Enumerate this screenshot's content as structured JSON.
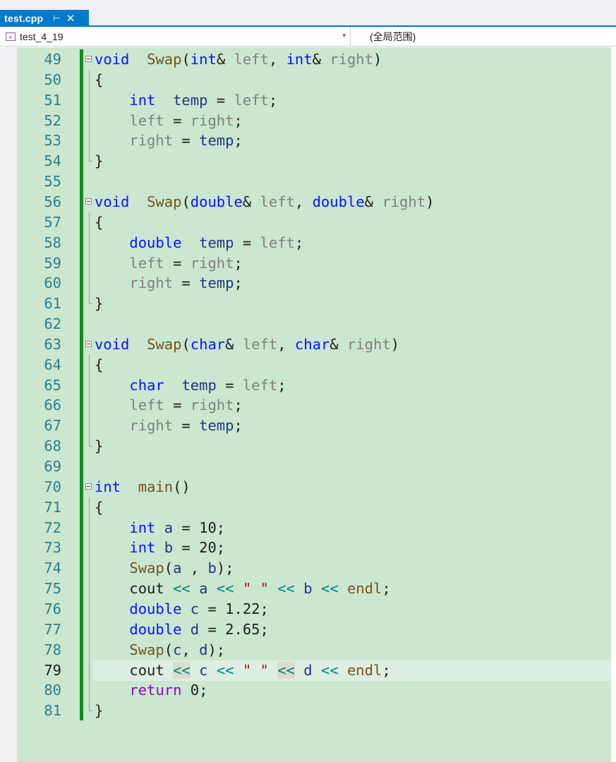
{
  "tab": {
    "title": "test.cpp",
    "pin_glyph": "⊢",
    "close_glyph": "✕"
  },
  "navbar": {
    "project": "test_4_19",
    "scope": "(全局范围)",
    "project_icon": "project-icon"
  },
  "editor": {
    "current_line": 79,
    "lines": [
      {
        "num": "49",
        "segs": [
          [
            "kw",
            "void"
          ],
          [
            "",
            "  "
          ],
          [
            "fn",
            "Swap"
          ],
          [
            "",
            "("
          ],
          [
            "kw",
            "int"
          ],
          [
            "",
            "& "
          ],
          [
            "prm",
            "left"
          ],
          [
            "",
            ", "
          ],
          [
            "kw",
            "int"
          ],
          [
            "",
            "& "
          ],
          [
            "prm",
            "right"
          ],
          [
            "",
            ")"
          ]
        ]
      },
      {
        "num": "50",
        "segs": [
          [
            "",
            "{"
          ]
        ]
      },
      {
        "num": "51",
        "segs": [
          [
            "",
            "    "
          ],
          [
            "kw",
            "int"
          ],
          [
            "",
            "  "
          ],
          [
            "lv",
            "temp"
          ],
          [
            "",
            " = "
          ],
          [
            "prm",
            "left"
          ],
          [
            "",
            ";"
          ]
        ]
      },
      {
        "num": "52",
        "segs": [
          [
            "",
            "    "
          ],
          [
            "prm",
            "left"
          ],
          [
            "",
            " = "
          ],
          [
            "prm",
            "right"
          ],
          [
            "",
            ";"
          ]
        ]
      },
      {
        "num": "53",
        "segs": [
          [
            "",
            "    "
          ],
          [
            "prm",
            "right"
          ],
          [
            "",
            " = "
          ],
          [
            "lv",
            "temp"
          ],
          [
            "",
            ";"
          ]
        ]
      },
      {
        "num": "54",
        "segs": [
          [
            "",
            "}"
          ]
        ]
      },
      {
        "num": "55",
        "segs": []
      },
      {
        "num": "56",
        "segs": [
          [
            "kw",
            "void"
          ],
          [
            "",
            "  "
          ],
          [
            "fn",
            "Swap"
          ],
          [
            "",
            "("
          ],
          [
            "kw",
            "double"
          ],
          [
            "",
            "& "
          ],
          [
            "prm",
            "left"
          ],
          [
            "",
            ", "
          ],
          [
            "kw",
            "double"
          ],
          [
            "",
            "& "
          ],
          [
            "prm",
            "right"
          ],
          [
            "",
            ")"
          ]
        ]
      },
      {
        "num": "57",
        "segs": [
          [
            "",
            "{"
          ]
        ]
      },
      {
        "num": "58",
        "segs": [
          [
            "",
            "    "
          ],
          [
            "kw",
            "double"
          ],
          [
            "",
            "  "
          ],
          [
            "lv",
            "temp"
          ],
          [
            "",
            " = "
          ],
          [
            "prm",
            "left"
          ],
          [
            "",
            ";"
          ]
        ]
      },
      {
        "num": "59",
        "segs": [
          [
            "",
            "    "
          ],
          [
            "prm",
            "left"
          ],
          [
            "",
            " = "
          ],
          [
            "prm",
            "right"
          ],
          [
            "",
            ";"
          ]
        ]
      },
      {
        "num": "60",
        "segs": [
          [
            "",
            "    "
          ],
          [
            "prm",
            "right"
          ],
          [
            "",
            " = "
          ],
          [
            "lv",
            "temp"
          ],
          [
            "",
            ";"
          ]
        ]
      },
      {
        "num": "61",
        "segs": [
          [
            "",
            "}"
          ]
        ]
      },
      {
        "num": "62",
        "segs": []
      },
      {
        "num": "63",
        "segs": [
          [
            "kw",
            "void"
          ],
          [
            "",
            "  "
          ],
          [
            "fn",
            "Swap"
          ],
          [
            "",
            "("
          ],
          [
            "kw",
            "char"
          ],
          [
            "",
            "& "
          ],
          [
            "prm",
            "left"
          ],
          [
            "",
            ", "
          ],
          [
            "kw",
            "char"
          ],
          [
            "",
            "& "
          ],
          [
            "prm",
            "right"
          ],
          [
            "",
            ")"
          ]
        ]
      },
      {
        "num": "64",
        "segs": [
          [
            "",
            "{"
          ]
        ]
      },
      {
        "num": "65",
        "segs": [
          [
            "",
            "    "
          ],
          [
            "kw",
            "char"
          ],
          [
            "",
            "  "
          ],
          [
            "lv",
            "temp"
          ],
          [
            "",
            " = "
          ],
          [
            "prm",
            "left"
          ],
          [
            "",
            ";"
          ]
        ]
      },
      {
        "num": "66",
        "segs": [
          [
            "",
            "    "
          ],
          [
            "prm",
            "left"
          ],
          [
            "",
            " = "
          ],
          [
            "prm",
            "right"
          ],
          [
            "",
            ";"
          ]
        ]
      },
      {
        "num": "67",
        "segs": [
          [
            "",
            "    "
          ],
          [
            "prm",
            "right"
          ],
          [
            "",
            " = "
          ],
          [
            "lv",
            "temp"
          ],
          [
            "",
            ";"
          ]
        ]
      },
      {
        "num": "68",
        "segs": [
          [
            "",
            "}"
          ]
        ]
      },
      {
        "num": "69",
        "segs": []
      },
      {
        "num": "70",
        "segs": [
          [
            "kw",
            "int"
          ],
          [
            "",
            "  "
          ],
          [
            "fn",
            "main"
          ],
          [
            "",
            "()"
          ]
        ]
      },
      {
        "num": "71",
        "segs": [
          [
            "",
            "{"
          ]
        ]
      },
      {
        "num": "72",
        "segs": [
          [
            "",
            "    "
          ],
          [
            "kw",
            "int"
          ],
          [
            "",
            " "
          ],
          [
            "lv",
            "a"
          ],
          [
            "",
            " = 10;"
          ]
        ]
      },
      {
        "num": "73",
        "segs": [
          [
            "",
            "    "
          ],
          [
            "kw",
            "int"
          ],
          [
            "",
            " "
          ],
          [
            "lv",
            "b"
          ],
          [
            "",
            " = 20;"
          ]
        ]
      },
      {
        "num": "74",
        "segs": [
          [
            "",
            "    "
          ],
          [
            "fn",
            "Swap"
          ],
          [
            "",
            "("
          ],
          [
            "lv",
            "a"
          ],
          [
            "",
            " , "
          ],
          [
            "lv",
            "b"
          ],
          [
            "",
            ");"
          ]
        ]
      },
      {
        "num": "75",
        "segs": [
          [
            "",
            "    cout "
          ],
          [
            "op",
            "<<"
          ],
          [
            "",
            " "
          ],
          [
            "lv",
            "a"
          ],
          [
            "",
            " "
          ],
          [
            "op",
            "<<"
          ],
          [
            "",
            " "
          ],
          [
            "str",
            "\" \""
          ],
          [
            "",
            " "
          ],
          [
            "op",
            "<<"
          ],
          [
            "",
            " "
          ],
          [
            "lv",
            "b"
          ],
          [
            "",
            " "
          ],
          [
            "op",
            "<<"
          ],
          [
            "",
            " "
          ],
          [
            "fn",
            "endl"
          ],
          [
            "",
            ";"
          ]
        ]
      },
      {
        "num": "76",
        "segs": [
          [
            "",
            "    "
          ],
          [
            "kw",
            "double"
          ],
          [
            "",
            " "
          ],
          [
            "lv",
            "c"
          ],
          [
            "",
            " = 1.22;"
          ]
        ]
      },
      {
        "num": "77",
        "segs": [
          [
            "",
            "    "
          ],
          [
            "kw",
            "double"
          ],
          [
            "",
            " "
          ],
          [
            "lv",
            "d"
          ],
          [
            "",
            " = 2.65;"
          ]
        ]
      },
      {
        "num": "78",
        "segs": [
          [
            "",
            "    "
          ],
          [
            "fn",
            "Swap"
          ],
          [
            "",
            "("
          ],
          [
            "lv",
            "c"
          ],
          [
            "",
            ", "
          ],
          [
            "lv",
            "d"
          ],
          [
            "",
            ");"
          ]
        ]
      },
      {
        "num": "79",
        "segs": [
          [
            "",
            "    cout "
          ],
          [
            "op-hl",
            "<<"
          ],
          [
            "",
            " "
          ],
          [
            "lv",
            "c"
          ],
          [
            "",
            " "
          ],
          [
            "op",
            "<<"
          ],
          [
            "",
            " "
          ],
          [
            "str",
            "\" \""
          ],
          [
            "",
            " "
          ],
          [
            "op-hl",
            "<<"
          ],
          [
            "",
            " "
          ],
          [
            "lv",
            "d"
          ],
          [
            "",
            " "
          ],
          [
            "op",
            "<<"
          ],
          [
            "",
            " "
          ],
          [
            "fn",
            "endl"
          ],
          [
            "",
            ";"
          ]
        ]
      },
      {
        "num": "80",
        "segs": [
          [
            "",
            "    "
          ],
          [
            "ctl",
            "return"
          ],
          [
            "",
            " 0;"
          ]
        ]
      },
      {
        "num": "81",
        "segs": [
          [
            "",
            "}"
          ]
        ]
      }
    ]
  }
}
